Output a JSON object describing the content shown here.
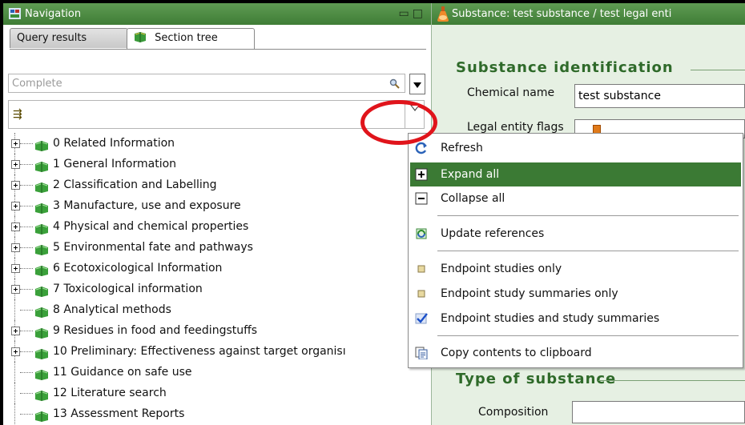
{
  "navigation": {
    "title": "Navigation",
    "tabs": [
      {
        "label": "Query results",
        "active": false
      },
      {
        "label": "Section tree",
        "active": true
      }
    ],
    "search": {
      "placeholder": "Complete"
    }
  },
  "tree": {
    "items": [
      {
        "label": "0 Related Information",
        "expandable": true
      },
      {
        "label": "1 General Information",
        "expandable": true
      },
      {
        "label": "2 Classification and Labelling",
        "expandable": true
      },
      {
        "label": "3 Manufacture, use and exposure",
        "expandable": true
      },
      {
        "label": "4 Physical and chemical properties",
        "expandable": true
      },
      {
        "label": "5 Environmental fate and pathways",
        "expandable": true
      },
      {
        "label": "6 Ecotoxicological Information",
        "expandable": true
      },
      {
        "label": "7 Toxicological information",
        "expandable": true
      },
      {
        "label": "8 Analytical methods",
        "expandable": false
      },
      {
        "label": "9 Residues in food and feedingstuffs",
        "expandable": true
      },
      {
        "label": "10 Preliminary: Effectiveness against target organisı",
        "expandable": true
      },
      {
        "label": "11 Guidance on safe use",
        "expandable": false
      },
      {
        "label": "12 Literature search",
        "expandable": false
      },
      {
        "label": "13 Assessment Reports",
        "expandable": false
      }
    ]
  },
  "substance": {
    "title": "Substance: test substance / test legal enti",
    "section1": "Substance identification",
    "chemical_name_label": "Chemical name",
    "chemical_name_value": "test substance",
    "legal_entity_flags_label": "Legal entity flags",
    "section2": "Type of substance",
    "composition_label": "Composition"
  },
  "menu": {
    "items": [
      {
        "label": "Refresh",
        "icon": "refresh-icon",
        "highlighted": false
      },
      {
        "label": "Expand all",
        "icon": "expand-all-icon",
        "highlighted": true
      },
      {
        "label": "Collapse all",
        "icon": "collapse-all-icon",
        "highlighted": false
      },
      {
        "label": "Update references",
        "icon": "update-references-icon",
        "highlighted": false
      },
      {
        "label": "Endpoint studies only",
        "icon": "radio-unselected-icon",
        "highlighted": false
      },
      {
        "label": "Endpoint study summaries only",
        "icon": "radio-unselected-icon",
        "highlighted": false
      },
      {
        "label": "Endpoint studies and study summaries",
        "icon": "checkmark-icon",
        "highlighted": false
      },
      {
        "label": "Copy contents to clipboard",
        "icon": "copy-icon",
        "highlighted": false
      }
    ]
  },
  "colors": {
    "title_bar": "#4a8a40",
    "highlight": "#3b7a34",
    "panel_bg": "#e6f0e3",
    "section_heading": "#2f6a2a",
    "annotation": "#e0141b"
  }
}
